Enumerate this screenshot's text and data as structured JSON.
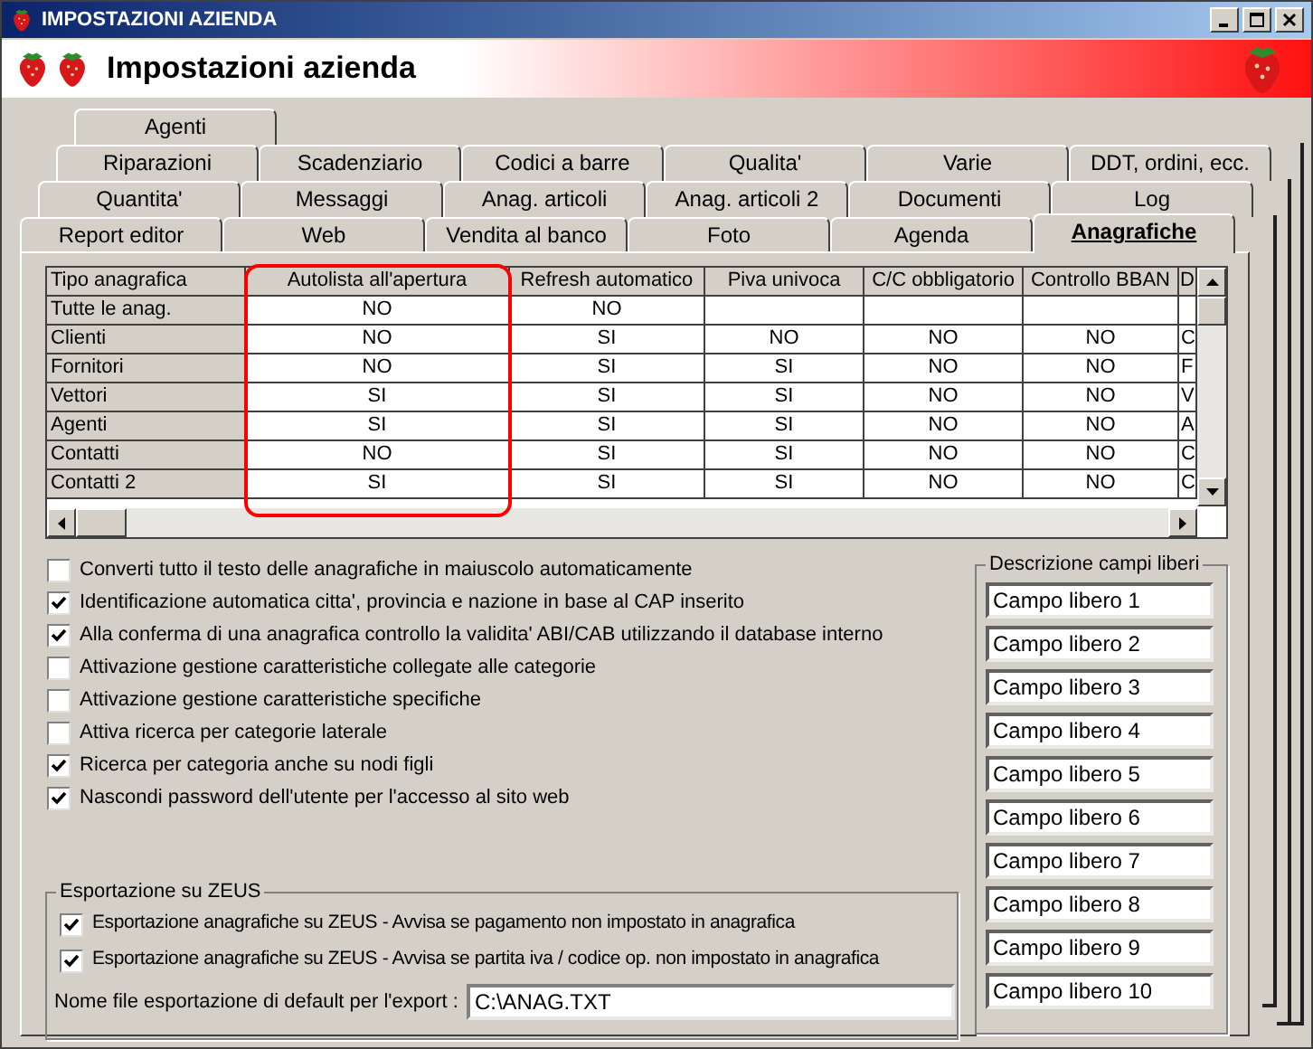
{
  "window": {
    "title": "IMPOSTAZIONI AZIENDA"
  },
  "banner": {
    "title": "Impostazioni azienda"
  },
  "tab_rows": [
    {
      "tabs": [
        {
          "label": "Agenti",
          "selected": false
        }
      ]
    },
    {
      "tabs": [
        {
          "label": "Riparazioni",
          "selected": false
        },
        {
          "label": "Scadenziario",
          "selected": false
        },
        {
          "label": "Codici a barre",
          "selected": false
        },
        {
          "label": "Qualita'",
          "selected": false
        },
        {
          "label": "Varie",
          "selected": false
        },
        {
          "label": "DDT, ordini, ecc.",
          "selected": false
        }
      ]
    },
    {
      "tabs": [
        {
          "label": "Quantita'",
          "selected": false
        },
        {
          "label": "Messaggi",
          "selected": false
        },
        {
          "label": "Anag. articoli",
          "selected": false
        },
        {
          "label": "Anag. articoli 2",
          "selected": false
        },
        {
          "label": "Documenti",
          "selected": false
        },
        {
          "label": "Log",
          "selected": false
        }
      ]
    },
    {
      "tabs": [
        {
          "label": "Report editor",
          "selected": false
        },
        {
          "label": "Web",
          "selected": false
        },
        {
          "label": "Vendita al banco",
          "selected": false
        },
        {
          "label": "Foto",
          "selected": false
        },
        {
          "label": "Agenda",
          "selected": false
        },
        {
          "label": "Anagrafiche",
          "selected": true
        }
      ]
    }
  ],
  "table": {
    "columns": [
      "Tipo anagrafica",
      "Autolista all'apertura",
      "Refresh automatico",
      "Piva univoca",
      "C/C obbligatorio",
      "Controllo BBAN",
      "D"
    ],
    "rows": [
      [
        "Tutte le anag.",
        "NO",
        "NO",
        "",
        "",
        "",
        ""
      ],
      [
        "Clienti",
        "NO",
        "SI",
        "NO",
        "NO",
        "NO",
        "C"
      ],
      [
        "Fornitori",
        "NO",
        "SI",
        "SI",
        "NO",
        "NO",
        "F"
      ],
      [
        "Vettori",
        "SI",
        "SI",
        "SI",
        "NO",
        "NO",
        "V"
      ],
      [
        "Agenti",
        "SI",
        "SI",
        "SI",
        "NO",
        "NO",
        "A"
      ],
      [
        "Contatti",
        "NO",
        "SI",
        "SI",
        "NO",
        "NO",
        "C"
      ],
      [
        "Contatti 2",
        "SI",
        "SI",
        "SI",
        "NO",
        "NO",
        "C"
      ]
    ]
  },
  "options": [
    {
      "label": "Converti tutto il testo delle anagrafiche in maiuscolo automaticamente",
      "checked": false
    },
    {
      "label": "Identificazione automatica citta', provincia e nazione in base al CAP inserito",
      "checked": true
    },
    {
      "label": "Alla conferma di una anagrafica controllo la validita' ABI/CAB utilizzando il database interno",
      "checked": true
    },
    {
      "label": "Attivazione gestione caratteristiche collegate alle categorie",
      "checked": false
    },
    {
      "label": "Attivazione gestione caratteristiche specifiche",
      "checked": false
    },
    {
      "label": "Attiva ricerca per categorie laterale",
      "checked": false
    },
    {
      "label": "Ricerca per categoria anche su nodi figli",
      "checked": true
    },
    {
      "label": "Nascondi password dell'utente per l'accesso al sito web",
      "checked": true
    }
  ],
  "export": {
    "title": "Esportazione su ZEUS",
    "options": [
      {
        "label": "Esportazione anagrafiche su ZEUS - Avvisa se pagamento non impostato in anagrafica",
        "checked": true
      },
      {
        "label": "Esportazione anagrafiche su ZEUS - Avvisa se partita iva / codice op. non impostato in anagrafica",
        "checked": true
      }
    ],
    "filename_label": "Nome file esportazione di default per l'export :",
    "filename_value": "C:\\ANAG.TXT"
  },
  "free_fields": {
    "title": "Descrizione campi liberi",
    "values": [
      "Campo libero 1",
      "Campo libero 2",
      "Campo libero 3",
      "Campo libero 4",
      "Campo libero 5",
      "Campo libero 6",
      "Campo libero 7",
      "Campo libero 8",
      "Campo libero 9",
      "Campo libero 10"
    ]
  }
}
